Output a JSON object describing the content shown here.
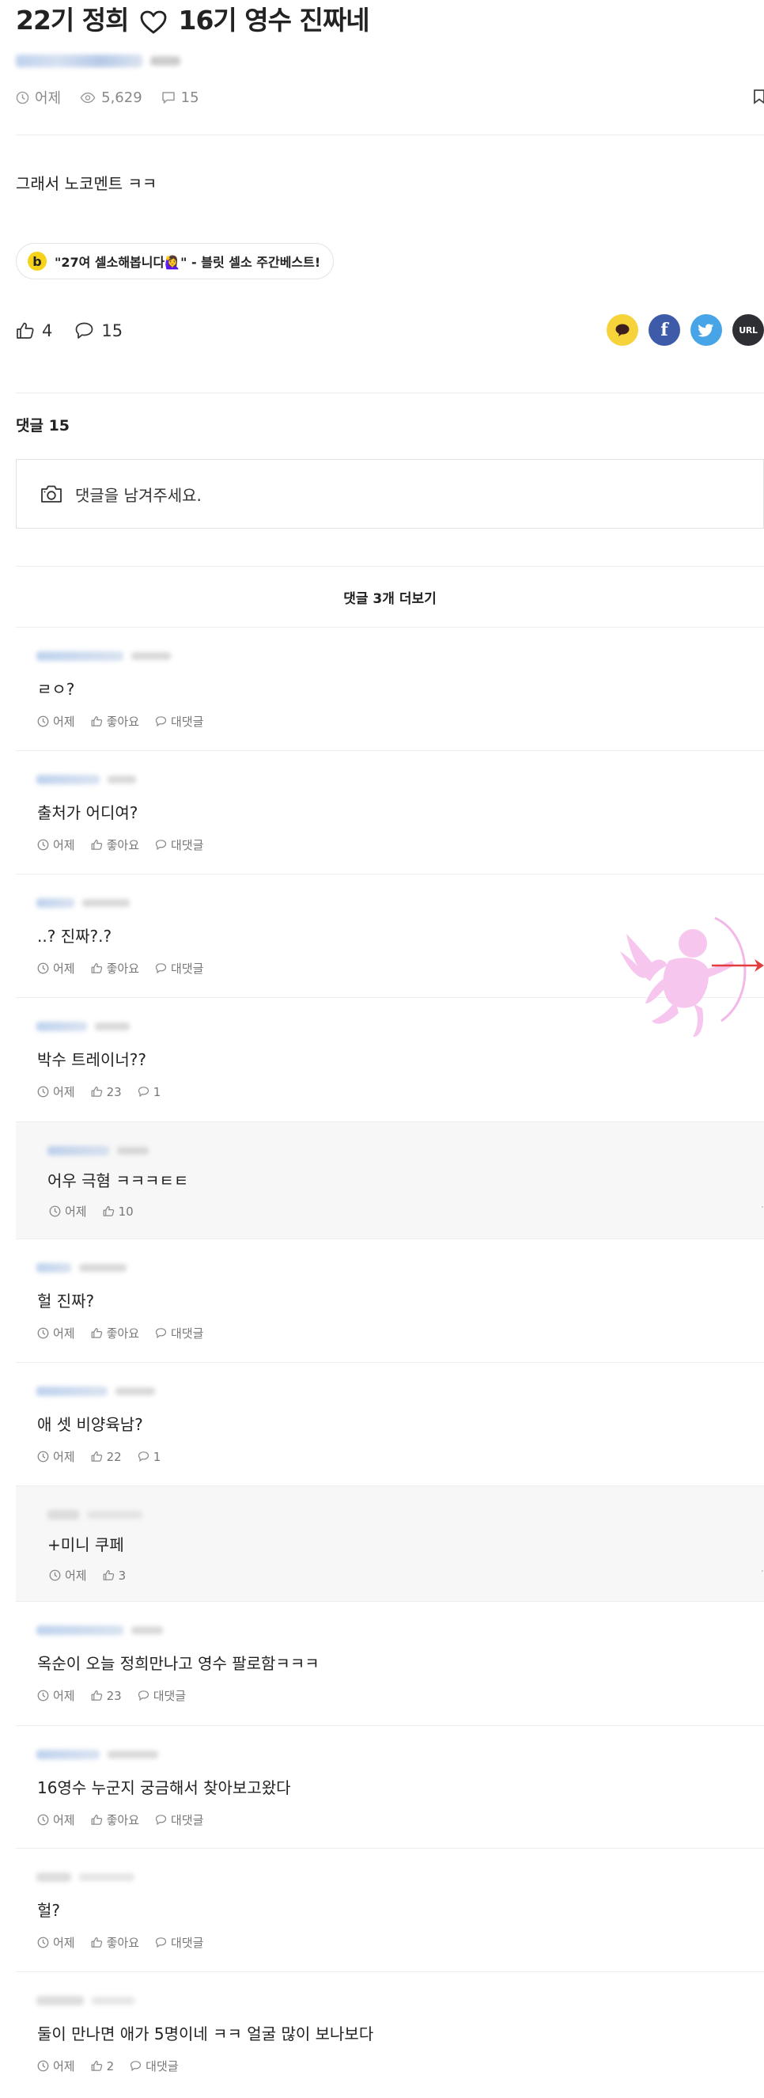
{
  "post": {
    "title_left": "22기 정희",
    "title_right": "16기 영수 진짜네",
    "time": "어제",
    "views": "5,629",
    "comment_count": "15",
    "body": "그래서 노코멘트 ㅋㅋ",
    "promo_text": "\"27여 셀소해봅니다🙋‍♀️\" - 블릿 셀소 주간베스트!",
    "promo_logo": "b",
    "likes": "4",
    "comments": "15"
  },
  "share": {
    "url_label": "URL",
    "colors": {
      "kakao": "#f6d33b",
      "facebook": "#3d5ba9",
      "twitter": "#47a4e6",
      "url": "#2d2f35"
    }
  },
  "comments_section": {
    "header": "댓글 15",
    "input_placeholder": "댓글을 남겨주세요.",
    "more_label": "댓글 3개 더보기"
  },
  "comments": [
    {
      "text": "ㄹㅇ?",
      "time": "어제",
      "like": "좋아요",
      "reply": "대댓글"
    },
    {
      "text": "출처가 어디여?",
      "time": "어제",
      "like": "좋아요",
      "reply": "대댓글"
    },
    {
      "text": "..? 진짜?.?",
      "time": "어제",
      "like": "좋아요",
      "reply": "대댓글"
    },
    {
      "text": "박수 트레이너??",
      "time": "어제",
      "like": "23",
      "reply": "1"
    },
    {
      "text": "어우 극혐 ㅋㅋㅋㅌㅌ",
      "time": "어제",
      "like": "10"
    },
    {
      "text": "헐 진짜?",
      "time": "어제",
      "like": "좋아요",
      "reply": "대댓글"
    },
    {
      "text": "애 셋 비양육남?",
      "time": "어제",
      "like": "22",
      "reply": "1"
    },
    {
      "text": "+미니 쿠페",
      "time": "어제",
      "like": "3"
    },
    {
      "text": "옥순이 오늘 정희만나고 영수 팔로함ㅋㅋㅋ",
      "time": "어제",
      "like": "23",
      "reply": "대댓글"
    },
    {
      "text": "16영수 누군지 궁금해서 찾아보고왔다",
      "time": "어제",
      "like": "좋아요",
      "reply": "대댓글"
    },
    {
      "text": "헐?",
      "time": "어제",
      "like": "좋아요",
      "reply": "대댓글"
    },
    {
      "text": "둘이 만나면 애가 5명이네 ㅋㅋ 얼굴 많이 보나보다",
      "time": "어제",
      "like": "2",
      "reply": "대댓글"
    }
  ]
}
